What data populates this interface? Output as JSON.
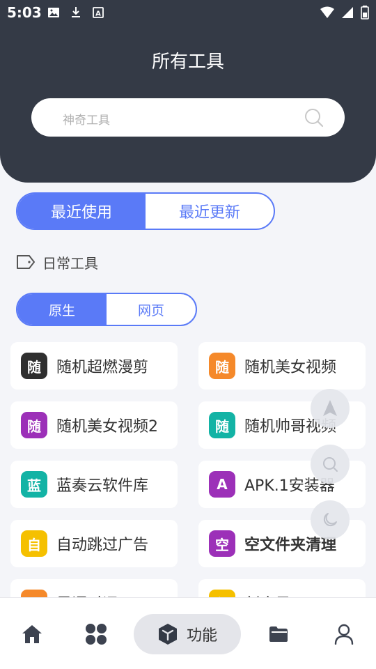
{
  "status_bar": {
    "time": "5:03"
  },
  "header": {
    "title": "所有工具"
  },
  "search": {
    "placeholder": "神奇工具"
  },
  "recent_tabs": [
    {
      "label": "最近使用",
      "active": true
    },
    {
      "label": "最近更新",
      "active": false
    }
  ],
  "category": {
    "label": "日常工具"
  },
  "type_tabs": [
    {
      "label": "原生",
      "active": true
    },
    {
      "label": "网页",
      "active": false
    }
  ],
  "tools": [
    {
      "badge": "随",
      "name": "随机超燃漫剪",
      "color": "#2f2f2f"
    },
    {
      "badge": "随",
      "name": "随机美女视频",
      "color": "#f5892a"
    },
    {
      "badge": "随",
      "name": "随机美女视频2",
      "color": "#9c30b8"
    },
    {
      "badge": "随",
      "name": "随机帅哥视频",
      "color": "#13b3a5"
    },
    {
      "badge": "蓝",
      "name": "蓝奏云软件库",
      "color": "#13b3a5"
    },
    {
      "badge": "A",
      "name": "APK.1安装器",
      "color": "#9c30b8"
    },
    {
      "badge": "自",
      "name": "自动跳过广告",
      "color": "#f5c000"
    },
    {
      "badge": "空",
      "name": "空文件夹清理",
      "color": "#9c30b8"
    },
    {
      "badge": "早",
      "name": "早语对词",
      "color": "#f5892a"
    },
    {
      "badge": "刻",
      "name": "刻度尺",
      "color": "#f5c000"
    }
  ],
  "bottom_nav": {
    "active_label": "功能"
  },
  "colors": {
    "header_bg": "#343a46",
    "accent": "#5a7af7",
    "page_bg": "#f4f5f9"
  }
}
